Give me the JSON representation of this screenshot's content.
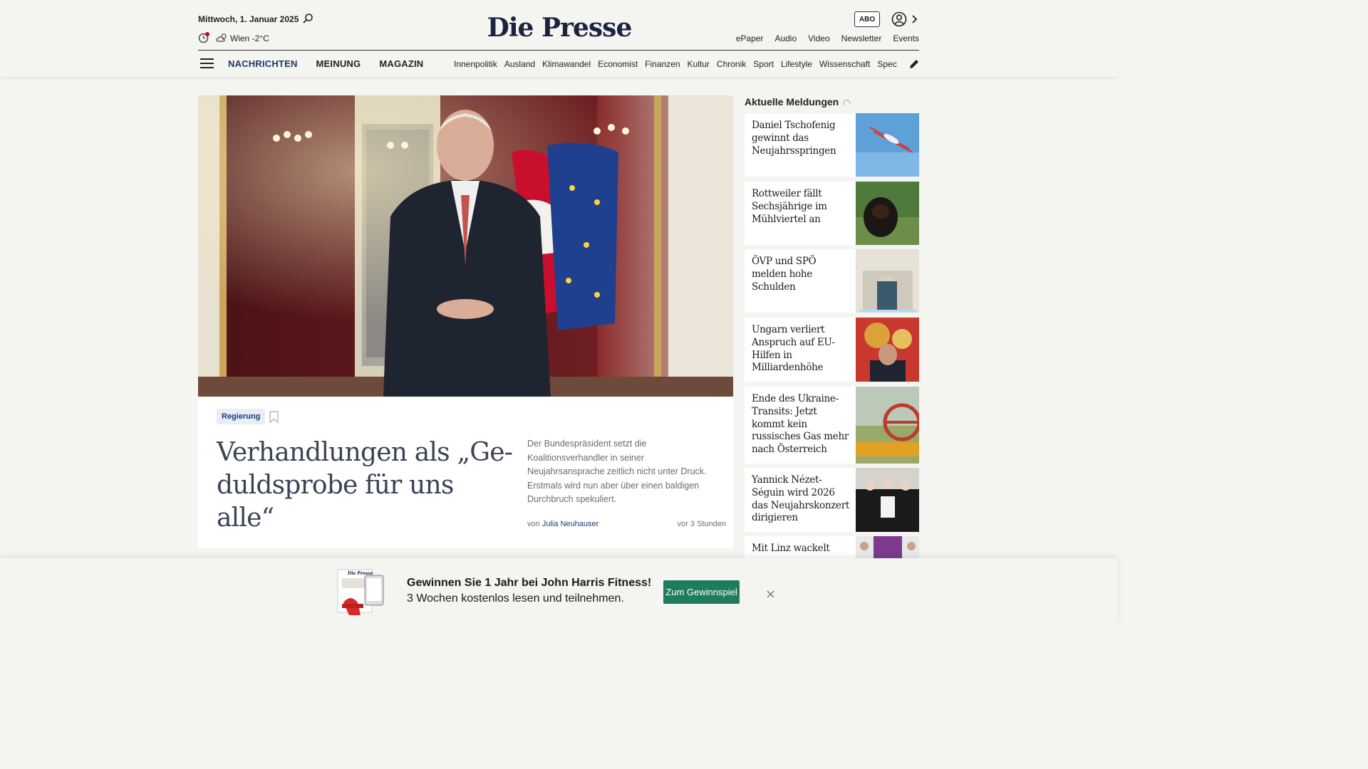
{
  "header": {
    "date": "Mittwoch, 1. Januar 2025",
    "weather": "Wien -2°C",
    "logo": "Die Presse",
    "abo_label": "ABO",
    "top_links": [
      "ePaper",
      "Audio",
      "Video",
      "Newsletter",
      "Events"
    ],
    "main_nav": [
      "NACHRICHTEN",
      "MEINUNG",
      "MAGAZIN"
    ],
    "sub_nav": [
      "Innenpolitik",
      "Ausland",
      "Klimawandel",
      "Economist",
      "Finanzen",
      "Kultur",
      "Chronik",
      "Sport",
      "Lifestyle",
      "Wissenschaft",
      "Spectrum"
    ]
  },
  "lead_article": {
    "tag": "Regierung",
    "headline": "Verhandlungen als „Geduldsprobe für uns alle“",
    "headline_line1": "Verhandlungen als „Ge-",
    "headline_line2": "duldsprobe für uns alle“",
    "teaser": "Der Bundespräsident setzt die Koalitionsverhandler in seiner Neujahrsansprache zeitlich nicht unter Druck. Erstmals wird nun aber über einen baldigen Durchbruch spekuliert.",
    "byline_prefix": "von",
    "author": "Julia Neuhauser",
    "time": "vor 3 Stunden"
  },
  "sidebar": {
    "title": "Aktuelle Meldungen",
    "items": [
      {
        "title": "Daniel Tschofenig gewinnt das Neujahrsspringen"
      },
      {
        "title": "Rottweiler fällt Sechsjährige im Mühlviertel an"
      },
      {
        "title": "ÖVP und SPÖ melden hohe Schulden"
      },
      {
        "title": "Ungarn verliert Anspruch auf EU-Hilfen in Milliardenhöhe"
      },
      {
        "title": "Ende des Ukraine-Transits: Jetzt kommt kein russisches Gas mehr nach Österreich"
      },
      {
        "title": "Yannick Nézet-Séguin wird 2026 das Neujahrskonzert dirigieren"
      },
      {
        "title": "Mit Linz wackelt"
      }
    ]
  },
  "promo": {
    "line1": "Gewinnen Sie 1 Jahr bei John Harris Fitness!",
    "line2": "3 Wochen kostenlos lesen und teilnehmen.",
    "button": "Zum Gewinnspiel",
    "mini_logo": "Die Presse"
  },
  "colors": {
    "brand_navy": "#1c2340",
    "nav_blue": "#1c3a6e",
    "cta_green": "#1f7c5d",
    "page_bg": "#f4f4f1"
  }
}
